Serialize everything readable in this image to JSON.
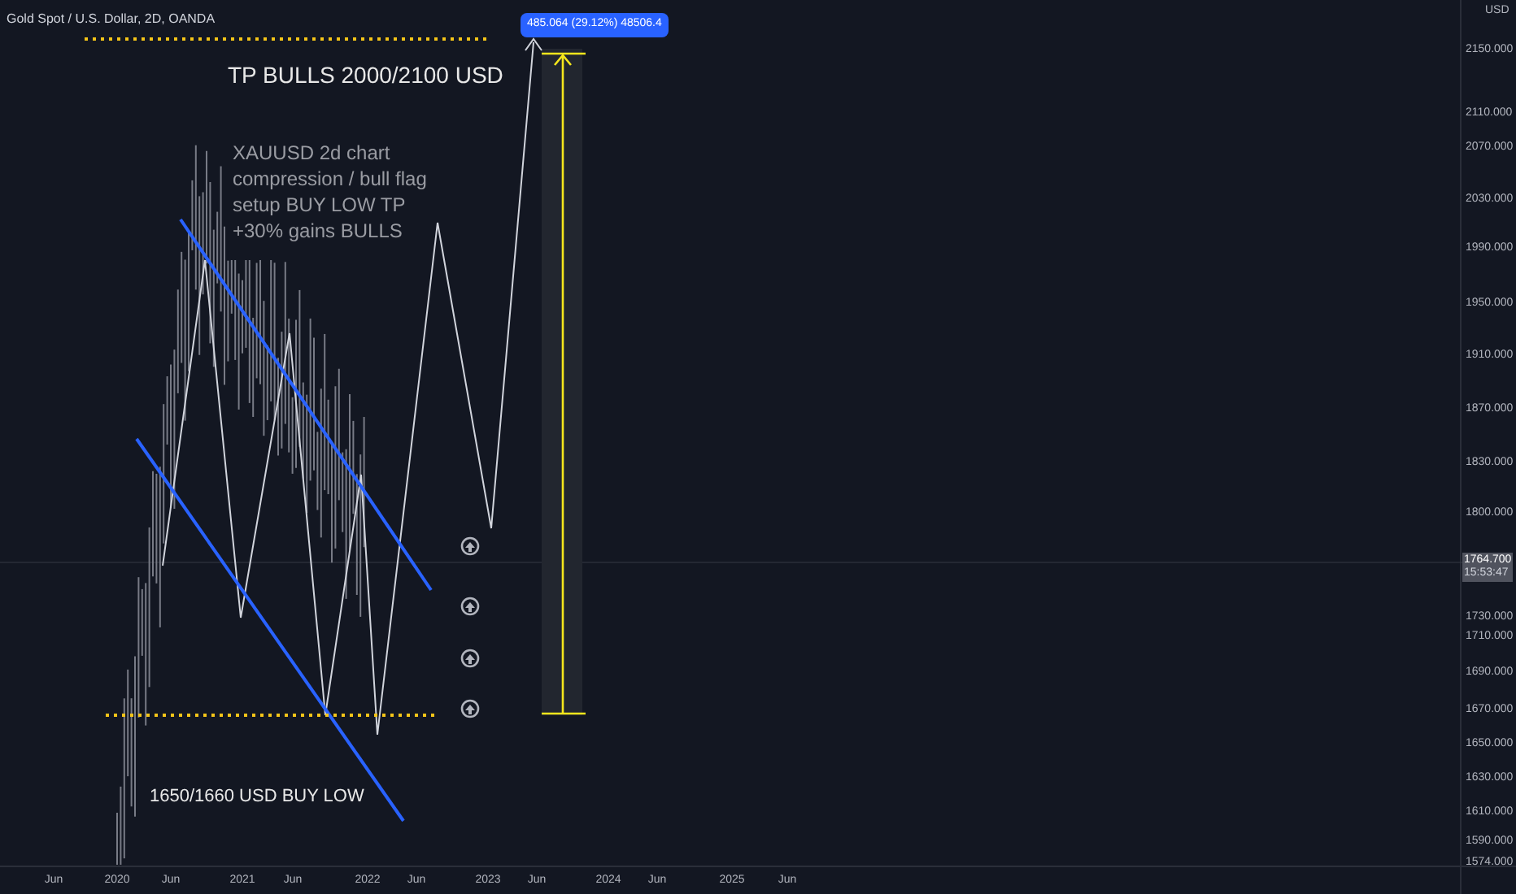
{
  "chart": {
    "title": "Gold Spot / U.S. Dollar, 2D, OANDA",
    "annotations": [
      {
        "kind": "heading",
        "text": "TP BULLS 2000/2100 USD"
      },
      {
        "kind": "note",
        "text": "XAUUSD 2d chart\ncompression / bull flag\nsetup BUY LOW TP\n+30% gains BULLS"
      },
      {
        "kind": "label",
        "text": "1650/1660 USD BUY LOW"
      }
    ],
    "measure_label": "485.064 (29.12%) 48506.4"
  },
  "price_axis": {
    "unit": "USD",
    "labels": [
      "2150.000",
      "2110.000",
      "2070.000",
      "2030.000",
      "1990.000",
      "1950.000",
      "1910.000",
      "1870.000",
      "1830.000",
      "1800.000",
      "1730.000",
      "1710.000",
      "1690.000",
      "1670.000",
      "1650.000",
      "1630.000",
      "1610.000",
      "1590.000",
      "1574.000"
    ],
    "last_price": {
      "value": "1764.700",
      "countdown": "15:53:47"
    }
  },
  "time_axis": {
    "labels": [
      "Jun",
      "2020",
      "Jun",
      "2021",
      "Jun",
      "2022",
      "Jun",
      "2023",
      "Jun",
      "2024",
      "Jun",
      "2025",
      "Jun"
    ]
  }
}
